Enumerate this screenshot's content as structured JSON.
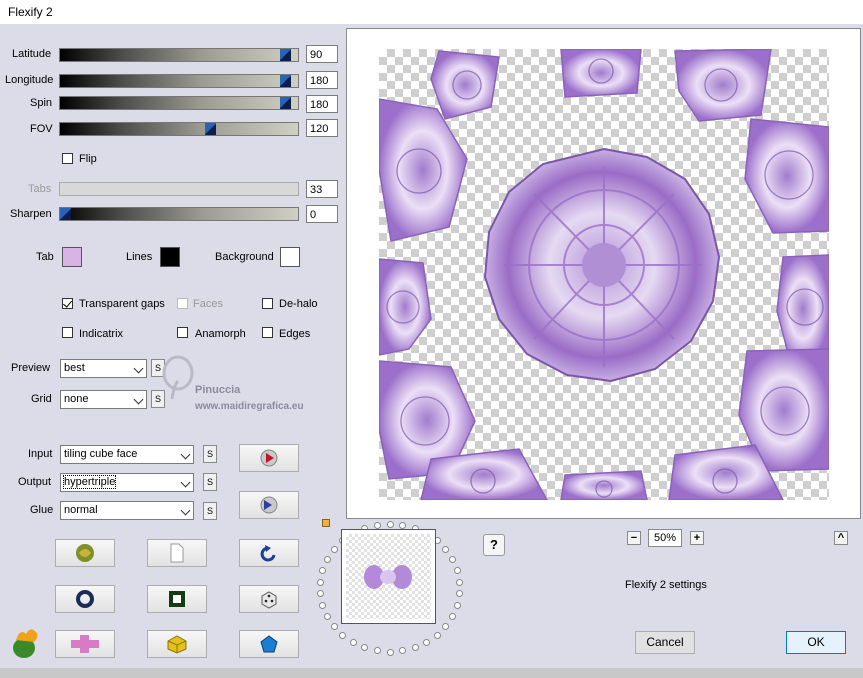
{
  "window": {
    "title": "Flexify 2"
  },
  "sliders": [
    {
      "label": "Latitude",
      "value": "90",
      "fraction": 0.97
    },
    {
      "label": "Longitude",
      "value": "180",
      "fraction": 0.97
    },
    {
      "label": "Spin",
      "value": "180",
      "fraction": 0.97
    },
    {
      "label": "FOV",
      "value": "120",
      "fraction": 0.64
    },
    {
      "label": "Tabs",
      "value": "33",
      "fraction": 0.0,
      "disabled": true
    },
    {
      "label": "Sharpen",
      "value": "0",
      "fraction": 0.0
    }
  ],
  "flip": {
    "label": "Flip",
    "checked": false
  },
  "colors": {
    "tab": {
      "label": "Tab",
      "hex": "#d9b3e3"
    },
    "lines": {
      "label": "Lines",
      "hex": "#000000"
    },
    "background": {
      "label": "Background",
      "hex": "#ffffff"
    }
  },
  "options": {
    "transparent_gaps": {
      "label": "Transparent gaps",
      "checked": true
    },
    "faces": {
      "label": "Faces",
      "checked": false,
      "disabled": true
    },
    "dehalo": {
      "label": "De-halo",
      "checked": false
    },
    "indicatrix": {
      "label": "Indicatrix",
      "checked": false
    },
    "anamorph": {
      "label": "Anamorph",
      "checked": false
    },
    "edges": {
      "label": "Edges",
      "checked": false
    }
  },
  "preview_select": {
    "label": "Preview",
    "value": "best",
    "s": "S"
  },
  "grid_select": {
    "label": "Grid",
    "value": "none",
    "s": "S"
  },
  "input_select": {
    "label": "Input",
    "value": "tiling cube face",
    "s": "S"
  },
  "output_select": {
    "label": "Output",
    "value": "hypertriple",
    "s": "S"
  },
  "glue_select": {
    "label": "Glue",
    "value": "normal",
    "s": "S"
  },
  "watermark": {
    "line1": "Pinuccia",
    "line2": "www.maidiregrafica.eu"
  },
  "zoom": {
    "minus": "−",
    "value": "50%",
    "plus": "+"
  },
  "help": "?",
  "up": "^",
  "settings_label": "Flexify 2 settings",
  "buttons": {
    "cancel": "Cancel",
    "ok": "OK"
  },
  "accent": {
    "purple": "#a07ccc",
    "light_purple": "#d8c4ec",
    "dialog_bg": "#dcdce8",
    "ok_border": "#0078d7"
  },
  "icons": [
    "play-red-icon",
    "play-blue-icon",
    "swirl-icon",
    "new-doc-icon",
    "undo-icon",
    "ring-icon",
    "square-frame-icon",
    "dice-icon",
    "flame-logo-icon",
    "cross-icon",
    "cube-icon",
    "pentagon-icon"
  ]
}
